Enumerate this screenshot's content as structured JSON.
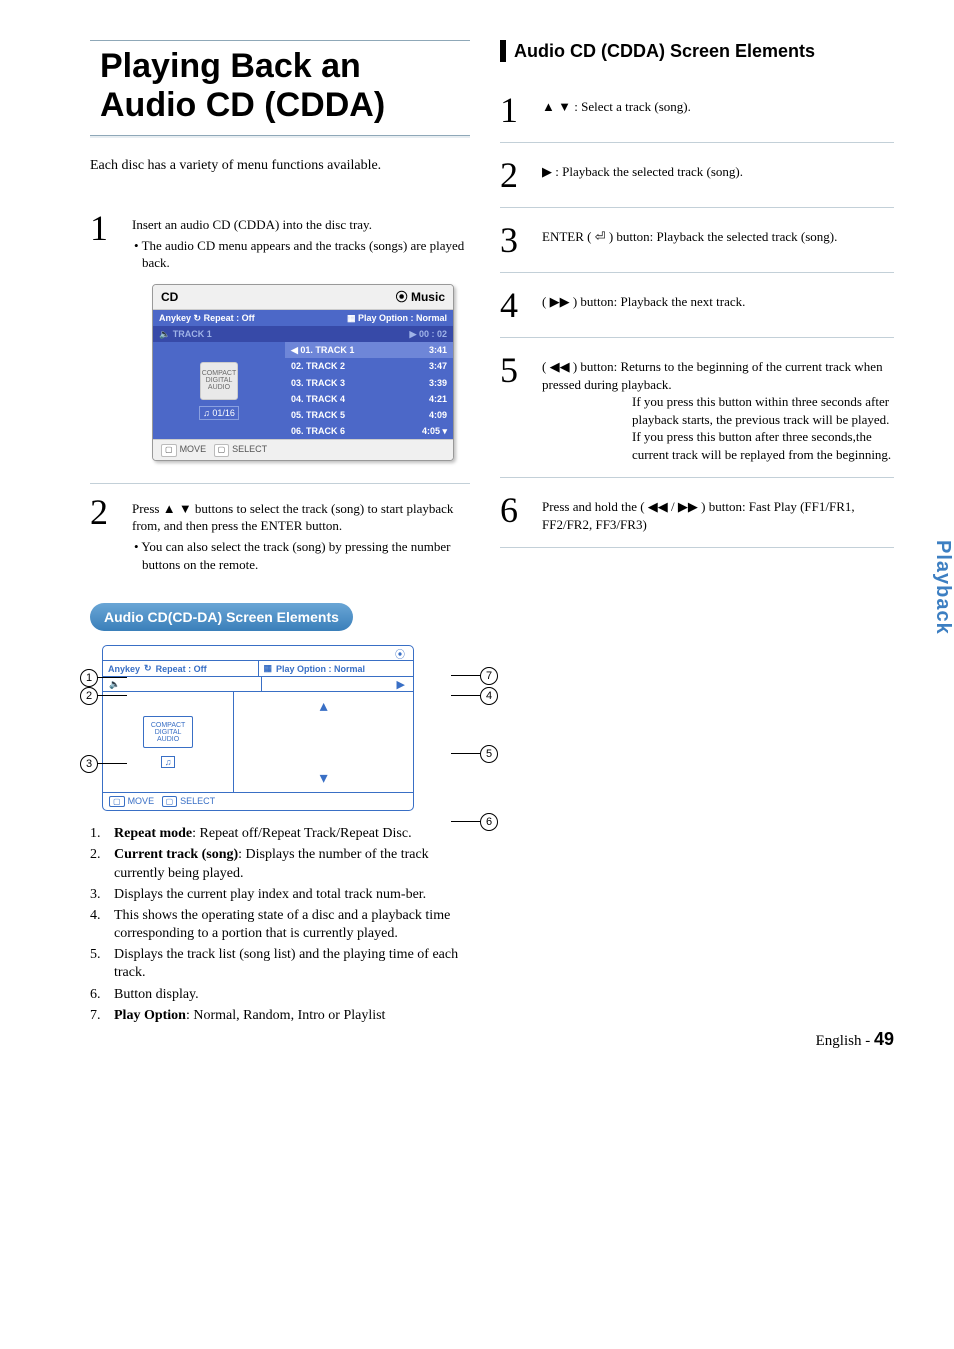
{
  "title": "Playing Back an Audio CD (CDDA)",
  "intro": "Each disc has a variety of menu functions available.",
  "left_steps": [
    {
      "num": "1",
      "main": "Insert an audio CD (CDDA) into the disc tray.",
      "sub": "• The audio CD menu appears and the tracks (songs) are played back."
    },
    {
      "num": "2",
      "main": "Press ▲ ▼ buttons to select the track (song) to start playback from, and then press the ENTER button.",
      "sub": "• You can also select the track (song) by pressing the number buttons on the remote."
    }
  ],
  "cd_shot": {
    "title_left": "CD",
    "title_right": "Music",
    "repeat_label": "Repeat : Off",
    "playopt_label": "Play Option : Normal",
    "current_track": "TRACK 1",
    "time": "00 : 02",
    "counter": "01/16",
    "tracks": [
      {
        "n": "01. TRACK 1",
        "t": "3:41"
      },
      {
        "n": "02. TRACK 2",
        "t": "3:47"
      },
      {
        "n": "03. TRACK 3",
        "t": "3:39"
      },
      {
        "n": "04. TRACK 4",
        "t": "4:21"
      },
      {
        "n": "05. TRACK 5",
        "t": "4:09"
      },
      {
        "n": "06. TRACK 6",
        "t": "4:05"
      }
    ],
    "foot_move": "MOVE",
    "foot_select": "SELECT",
    "disc_text": "COMPACT\nDIGITAL AUDIO"
  },
  "capsule": "Audio CD(CD-DA) Screen Elements",
  "wire": {
    "repeat": "Repeat : Off",
    "playopt": "Play Option : Normal",
    "foot_move": "MOVE",
    "foot_select": "SELECT",
    "disc_text": "COMPACT\nDIGITAL AUDIO"
  },
  "explanations": [
    {
      "n": "1.",
      "bold": "Repeat mode",
      "rest": ": Repeat off/Repeat Track/Repeat Disc."
    },
    {
      "n": "2.",
      "bold": "Current track (song)",
      "rest": ": Displays the number of the track currently being played."
    },
    {
      "n": "3.",
      "bold": "",
      "rest": "Displays the current play index and total track num-ber."
    },
    {
      "n": "4.",
      "bold": "",
      "rest": "This shows the operating state of a disc and a playback time corresponding to a portion that is currently played."
    },
    {
      "n": "5.",
      "bold": "",
      "rest": "Displays the track list (song list) and the playing time of each track."
    },
    {
      "n": "6.",
      "bold": "",
      "rest": "Button display."
    },
    {
      "n": "7.",
      "bold": "Play Option",
      "rest": ": Normal, Random, Intro or Playlist"
    }
  ],
  "right_heading": "Audio CD (CDDA) Screen Elements",
  "right_steps": [
    {
      "num": "1",
      "text": "▲ ▼ : Select a track (song)."
    },
    {
      "num": "2",
      "text": "▶ : Playback the selected track (song)."
    },
    {
      "num": "3",
      "text": "ENTER ( ⏎ ) button: Playback the selected track (song)."
    },
    {
      "num": "4",
      "text": "( ▶▶ ) button: Playback the next track."
    },
    {
      "num": "5",
      "text": "( ◀◀ ) button: Returns to the beginning of the current track when pressed during playback.",
      "extra": "If you press this button within three seconds after playback starts, the previous track will be played. If you press this button after three seconds,the current track will be replayed from the beginning."
    },
    {
      "num": "6",
      "text": "Press and hold the ( ◀◀ / ▶▶ ) button: Fast Play (FF1/FR1, FF2/FR2, FF3/FR3)"
    }
  ],
  "side_tab": "Playback",
  "footer_lang": "English - ",
  "footer_page": "49"
}
